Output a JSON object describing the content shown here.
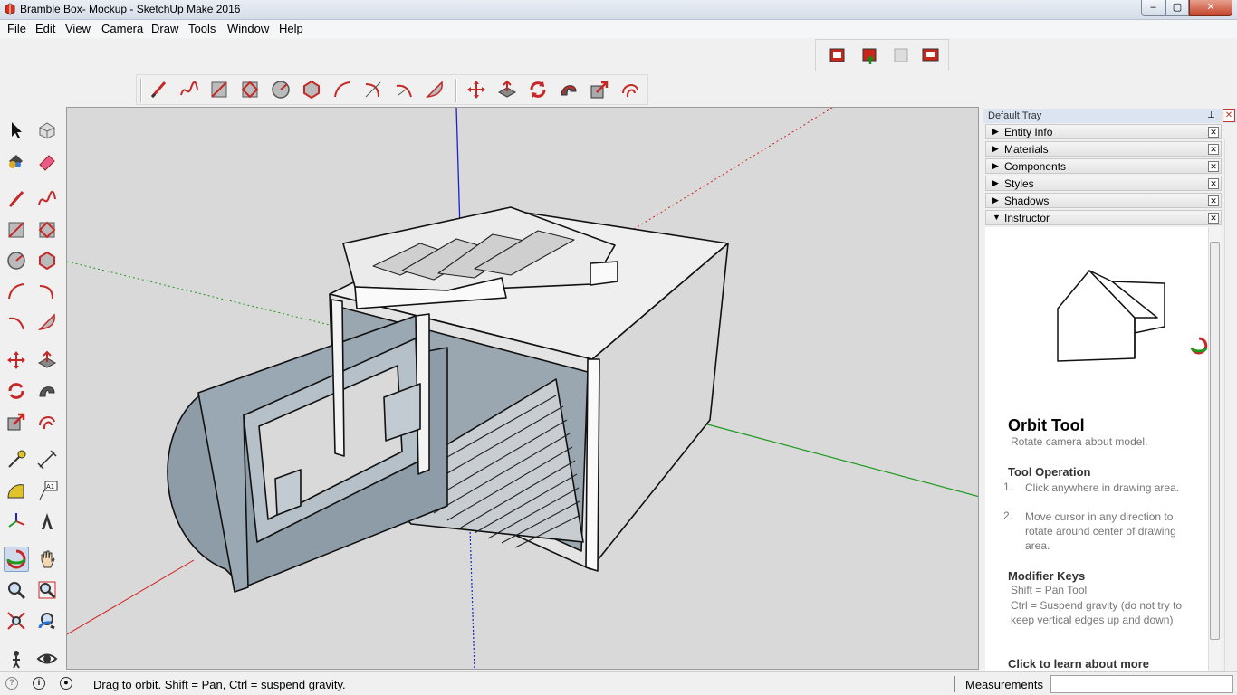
{
  "window": {
    "title": "Bramble Box- Mockup - SketchUp Make 2016",
    "controls": {
      "minimize": "–",
      "maximize": "▢",
      "close": "✕"
    }
  },
  "menu": [
    "File",
    "Edit",
    "View",
    "Camera",
    "Draw",
    "Tools",
    "Window",
    "Help"
  ],
  "draw_toolbar": [
    "line-tool",
    "freehand-tool",
    "rectangle-tool",
    "rotated-rectangle-tool",
    "circle-tool",
    "polygon-tool",
    "arc-tool",
    "2-point-arc-tool",
    "3-point-arc-tool",
    "pie-tool"
  ],
  "edit_toolbar": [
    "move-tool",
    "push-pull-tool",
    "rotate-tool",
    "follow-me-tool",
    "scale-tool",
    "offset-tool"
  ],
  "warehouse_toolbar": [
    "3d-warehouse-icon",
    "share-model-icon",
    "share-component-icon",
    "extension-warehouse-icon"
  ],
  "tray": {
    "title": "Default Tray",
    "pin": "⊥",
    "close": "✕",
    "panels": [
      {
        "label": "Entity Info",
        "arrow": "▶",
        "x": "✕"
      },
      {
        "label": "Materials",
        "arrow": "▶",
        "x": "✕"
      },
      {
        "label": "Components",
        "arrow": "▶",
        "x": "✕"
      },
      {
        "label": "Styles",
        "arrow": "▶",
        "x": "✕"
      },
      {
        "label": "Shadows",
        "arrow": "▶",
        "x": "✕"
      },
      {
        "label": "Instructor",
        "arrow": "▼",
        "x": "✕"
      }
    ]
  },
  "instructor": {
    "title": "Orbit Tool",
    "subtitle": "Rotate camera about model.",
    "operation_heading": "Tool Operation",
    "steps": [
      {
        "n": "1.",
        "text": "Click anywhere in drawing area."
      },
      {
        "n": "2.",
        "text": "Move cursor in any direction to rotate around center of drawing area."
      }
    ],
    "modifier_heading": "Modifier Keys",
    "modifiers": [
      "Shift = Pan Tool",
      "Ctrl = Suspend gravity (do not try to keep vertical edges up and down)"
    ],
    "link": "Click to learn about more"
  },
  "status": {
    "hint": "Drag to orbit. Shift = Pan, Ctrl = suspend gravity.",
    "icons": [
      "geo-location-icon",
      "credits-icon",
      "user-account-icon"
    ],
    "measurements_label": "Measurements",
    "measurements_value": ""
  },
  "colors": {
    "viewport_bg": "#d9d9d9",
    "axis_red": "#d32020",
    "axis_green": "#1f9a1f",
    "axis_blue": "#2020c8",
    "model_face": "#f5f5f5",
    "model_back": "#8a9ba8",
    "tray_header": "#dbe4f0"
  }
}
